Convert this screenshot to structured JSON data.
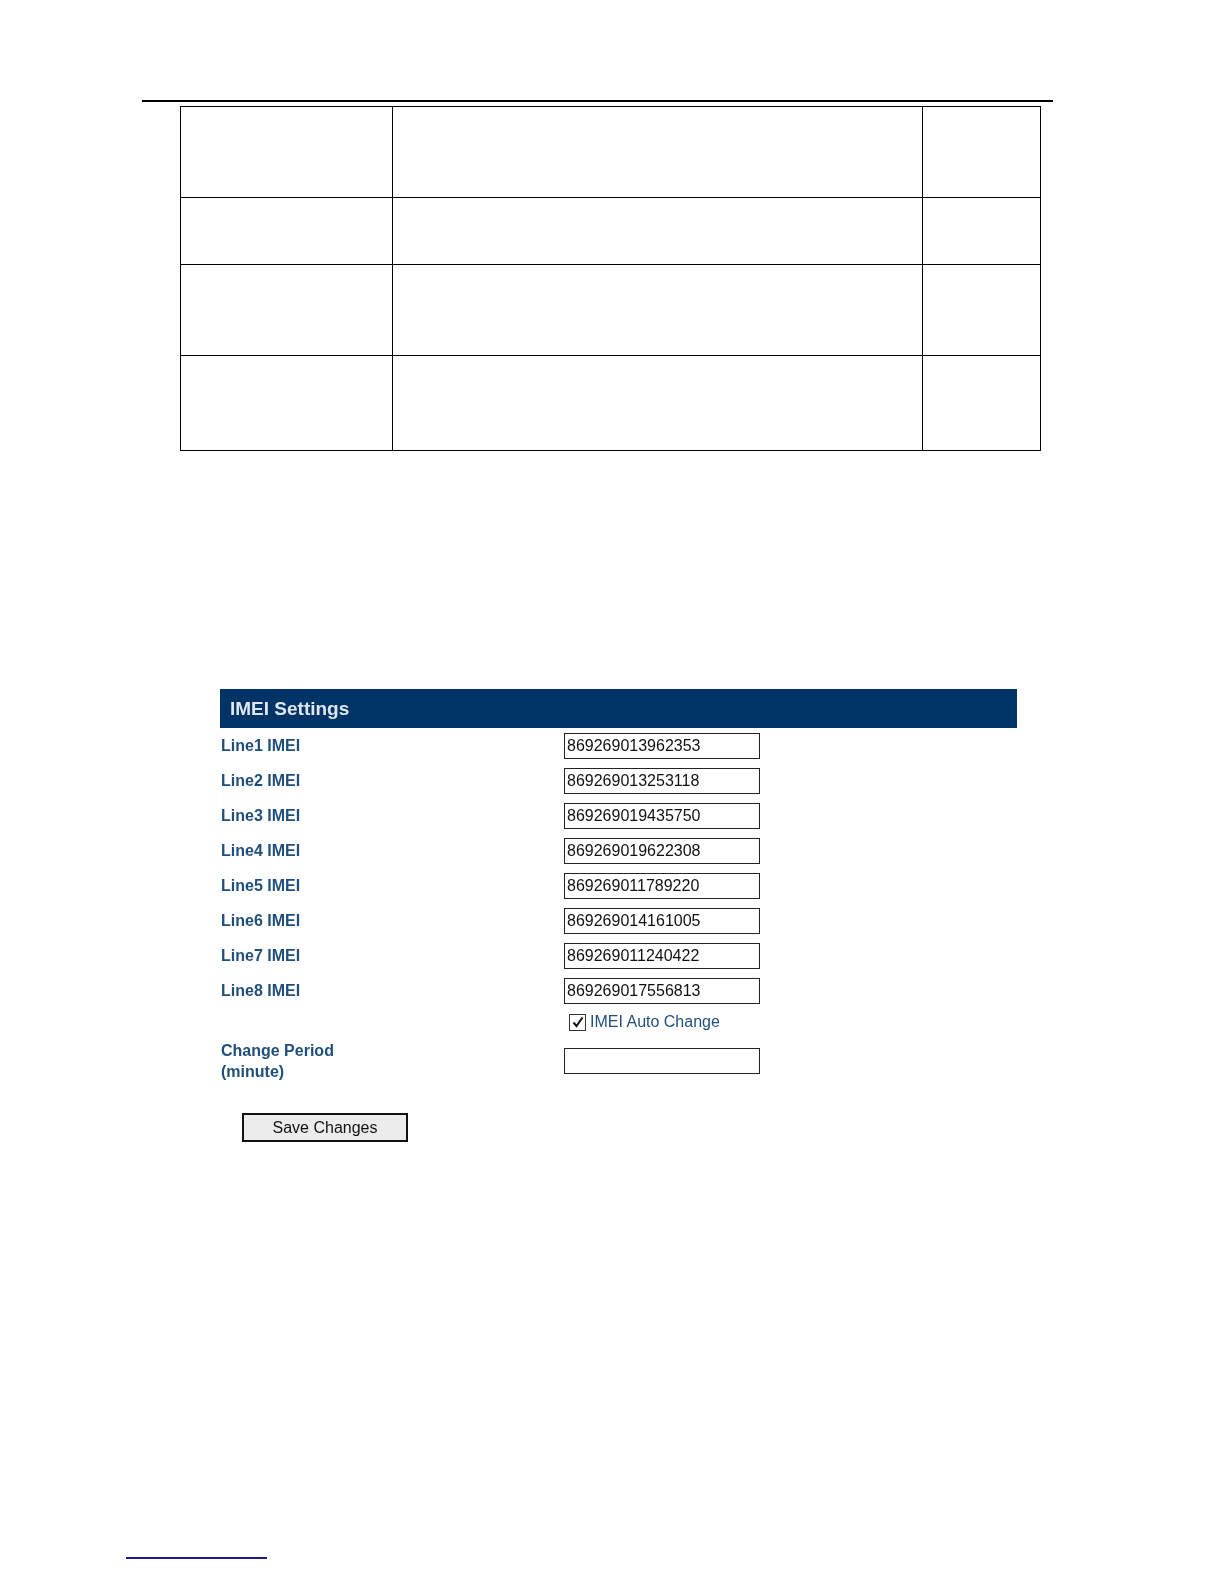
{
  "panel": {
    "title": "IMEI Settings",
    "lines": [
      {
        "label": "Line1 IMEI",
        "value": "869269013962353"
      },
      {
        "label": "Line2 IMEI",
        "value": "869269013253118"
      },
      {
        "label": "Line3 IMEI",
        "value": "869269019435750"
      },
      {
        "label": "Line4 IMEI",
        "value": "869269019622308"
      },
      {
        "label": "Line5 IMEI",
        "value": "869269011789220"
      },
      {
        "label": "Line6 IMEI",
        "value": "869269014161005"
      },
      {
        "label": "Line7 IMEI",
        "value": "869269011240422"
      },
      {
        "label": "Line8 IMEI",
        "value": "869269017556813"
      }
    ],
    "auto_change": {
      "label": "IMEI Auto Change",
      "checked": true
    },
    "change_period": {
      "label_lines": [
        "Change Period",
        "(minute)"
      ]
    },
    "save_button": "Save Changes"
  }
}
